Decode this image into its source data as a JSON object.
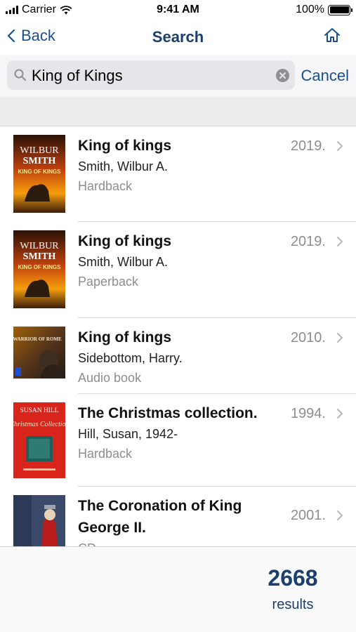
{
  "status_bar": {
    "carrier": "Carrier",
    "time": "9:41 AM",
    "battery": "100%",
    "battery_level": 1.0
  },
  "nav": {
    "back_label": "Back",
    "title": "Search",
    "home_icon": "home-icon"
  },
  "search": {
    "query": "King of Kings",
    "cancel_label": "Cancel"
  },
  "results": [
    {
      "title": "King of kings",
      "author": "Smith, Wilbur A.",
      "format": "Hardback",
      "year": "2019."
    },
    {
      "title": "King of kings",
      "author": "Smith, Wilbur A.",
      "format": "Paperback",
      "year": "2019."
    },
    {
      "title": "King of kings",
      "author": "Sidebottom, Harry.",
      "format": "Audio book",
      "year": "2010."
    },
    {
      "title": "The Christmas collection.",
      "author": "Hill, Susan, 1942-",
      "format": "Hardback",
      "year": "1994."
    },
    {
      "title": "The Coronation of King George II.",
      "author": "",
      "format": "CD",
      "year": "2001."
    }
  ],
  "covers": {
    "wilbur_top": "WILBUR",
    "wilbur_name": "SMITH",
    "wilbur_title": "KING OF KINGS",
    "warrior_title": "WARRIOR OF ROME",
    "hill_author": "SUSAN HILL",
    "hill_title": "Christmas Collection"
  },
  "footer": {
    "count": "2668",
    "label": "results"
  },
  "colors": {
    "accent": "#1a4f8f",
    "title_navy": "#1c3f6e",
    "secondary_text": "#8d8d92"
  }
}
